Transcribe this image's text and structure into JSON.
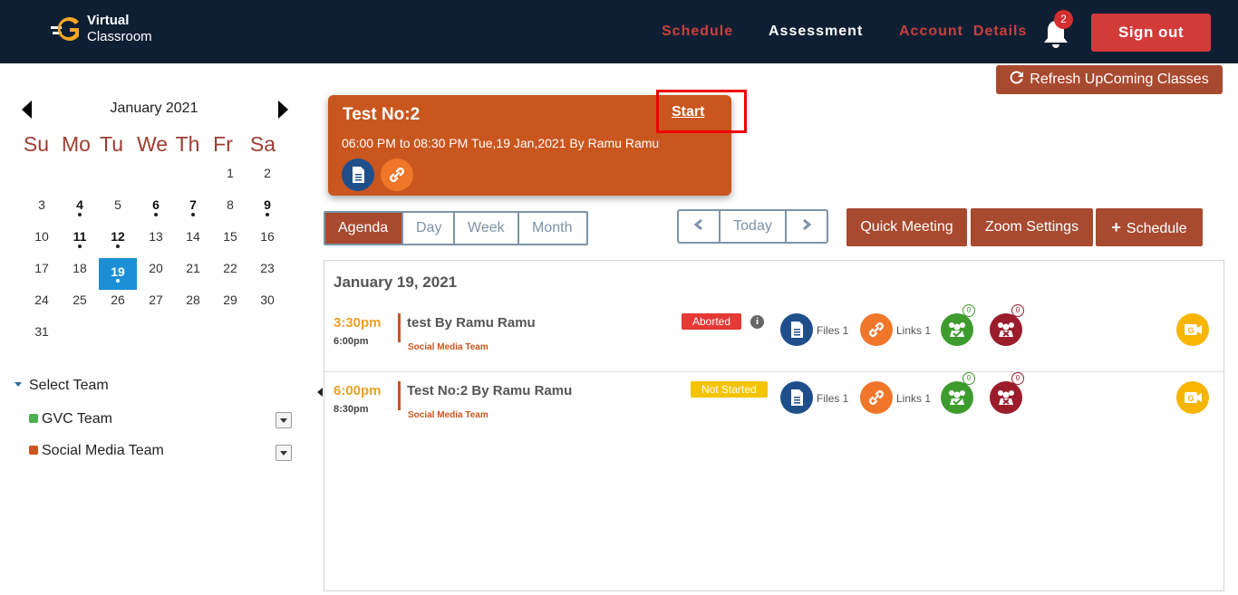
{
  "brand": {
    "line1": "Virtual",
    "line2": "Classroom",
    "logo_letter": "G",
    "logo_color": "#f5a623"
  },
  "nav": {
    "schedule": "Schedule",
    "assessment": "Assessment",
    "account": "Account  Details",
    "notifications_count": "2",
    "signout": "Sign out"
  },
  "refresh_label": "Refresh UpComing Classes",
  "calendar": {
    "month": "January 2021",
    "weekdays": [
      "Su",
      "Mo",
      "Tu",
      "We",
      "Th",
      "Fr",
      "Sa"
    ],
    "selected_day": "19"
  },
  "teams": {
    "heading": "Select Team",
    "items": [
      {
        "name": "GVC Team",
        "color": "#4caf50"
      },
      {
        "name": "Social Media Team",
        "color": "#c9561e"
      }
    ]
  },
  "upcoming": {
    "title": "Test No:2",
    "start": "Start",
    "when": "06:00 PM to 08:30 PM Tue,19 Jan,2021 By Ramu Ramu"
  },
  "views": {
    "agenda": "Agenda",
    "day": "Day",
    "week": "Week",
    "month": "Month"
  },
  "navigation": {
    "today": "Today"
  },
  "actions": {
    "quick": "Quick Meeting",
    "zoom": "Zoom Settings",
    "schedule": "Schedule"
  },
  "agenda": {
    "date": "January 19, 2021",
    "events": [
      {
        "start": "3:30pm",
        "end": "6:00pm",
        "title": "test By Ramu Ramu",
        "team": "Social Media Team",
        "status": "Aborted",
        "files": "Files 1",
        "links": "Links 1",
        "joined": "0",
        "absent": "0"
      },
      {
        "start": "6:00pm",
        "end": "8:30pm",
        "title": "Test No:2 By Ramu Ramu",
        "team": "Social Media Team",
        "status": "Not Started",
        "files": "Files 1",
        "links": "Links 1",
        "joined": "0",
        "absent": "0"
      }
    ]
  }
}
